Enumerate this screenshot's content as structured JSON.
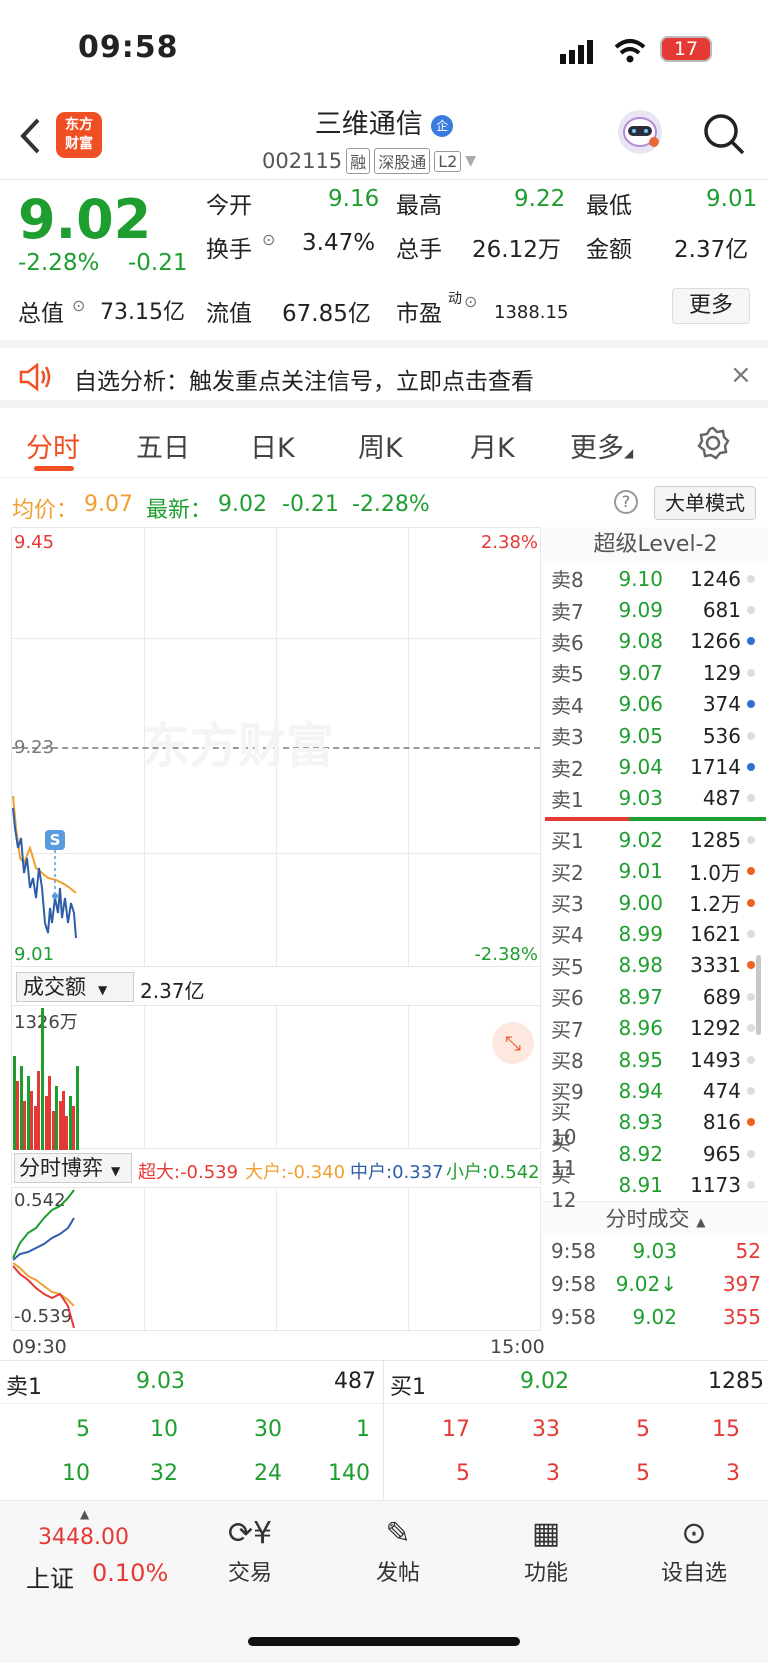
{
  "status": {
    "time": "09:58",
    "battery": "17"
  },
  "header": {
    "logo_line1": "东方",
    "logo_line2": "财富",
    "title": "三维通信",
    "code": "002115",
    "tags": [
      "融",
      "深股通",
      "L2"
    ],
    "title_badge": "企"
  },
  "quote": {
    "price": "9.02",
    "change_pct": "-2.28%",
    "change": "-0.21",
    "open_label": "今开",
    "open": "9.16",
    "high_label": "最高",
    "high": "9.22",
    "low_label": "最低",
    "low": "9.01",
    "turnover_label": "换手",
    "turnover": "3.47%",
    "volume_label": "总手",
    "volume": "26.12万",
    "amount_label": "金额",
    "amount": "2.37亿",
    "mktcap_label": "总值",
    "mktcap": "73.15亿",
    "float_label": "流值",
    "float": "67.85亿",
    "pe_label": "市盈",
    "pe_sup": "动",
    "pe": "1388.15",
    "more": "更多"
  },
  "notice": {
    "text": "自选分析：触发重点关注信号，立即点击查看"
  },
  "tabs": [
    "分时",
    "五日",
    "日K",
    "周K",
    "月K",
    "更多"
  ],
  "avgbar": {
    "avg_label": "均价：",
    "avg": "9.07",
    "latest_label": "最新：",
    "latest": "9.02",
    "chg": "-0.21",
    "pct": "-2.28%",
    "mode": "大单模式"
  },
  "chart": {
    "top_price": "9.45",
    "mid_price": "9.23",
    "bot_price": "9.01",
    "top_pct": "2.38%",
    "bot_pct": "-2.38%",
    "watermark": "东方财富",
    "signal": "S",
    "vol_label": "成交额",
    "vol_value": "2.37亿",
    "vol_max": "1326万",
    "game_label": "分时博弈",
    "chao": "超大:-0.539",
    "da": "大户:-0.340",
    "zhong": "中户:0.337",
    "xiao": "小户:0.542",
    "game_max": "0.542",
    "game_min": "-0.539",
    "t_start": "09:30",
    "t_end": "15:00"
  },
  "orderbook": {
    "title": "超级Level-2",
    "asks": [
      {
        "n": "卖8",
        "p": "9.10",
        "v": "1246"
      },
      {
        "n": "卖7",
        "p": "9.09",
        "v": "681"
      },
      {
        "n": "卖6",
        "p": "9.08",
        "v": "1266"
      },
      {
        "n": "卖5",
        "p": "9.07",
        "v": "129"
      },
      {
        "n": "卖4",
        "p": "9.06",
        "v": "374"
      },
      {
        "n": "卖3",
        "p": "9.05",
        "v": "536"
      },
      {
        "n": "卖2",
        "p": "9.04",
        "v": "1714"
      },
      {
        "n": "卖1",
        "p": "9.03",
        "v": "487"
      }
    ],
    "bids": [
      {
        "n": "买1",
        "p": "9.02",
        "v": "1285"
      },
      {
        "n": "买2",
        "p": "9.01",
        "v": "1.0万"
      },
      {
        "n": "买3",
        "p": "9.00",
        "v": "1.2万"
      },
      {
        "n": "买4",
        "p": "8.99",
        "v": "1621"
      },
      {
        "n": "买5",
        "p": "8.98",
        "v": "3331"
      },
      {
        "n": "买6",
        "p": "8.97",
        "v": "689"
      },
      {
        "n": "买7",
        "p": "8.96",
        "v": "1292"
      },
      {
        "n": "买8",
        "p": "8.95",
        "v": "1493"
      },
      {
        "n": "买9",
        "p": "8.94",
        "v": "474"
      },
      {
        "n": "买10",
        "p": "8.93",
        "v": "816"
      },
      {
        "n": "买11",
        "p": "8.92",
        "v": "965"
      },
      {
        "n": "买12",
        "p": "8.91",
        "v": "1173"
      }
    ],
    "ticks_title": "分时成交",
    "ticks": [
      {
        "t": "9:58",
        "p": "9.03",
        "v": "52"
      },
      {
        "t": "9:58",
        "p": "9.02↓",
        "v": "397"
      },
      {
        "t": "9:58",
        "p": "9.02",
        "v": "355"
      }
    ]
  },
  "level1": {
    "ask_label": "卖1",
    "ask_p": "9.03",
    "ask_v": "487",
    "bid_label": "买1",
    "bid_p": "9.02",
    "bid_v": "1285",
    "ask_q1": [
      "5",
      "10",
      "30",
      "1"
    ],
    "ask_q2": [
      "10",
      "32",
      "24",
      "140"
    ],
    "bid_q1": [
      "17",
      "33",
      "5",
      "15"
    ],
    "bid_q2": [
      "5",
      "3",
      "5",
      "3"
    ]
  },
  "nav": {
    "index_value": "3448.00",
    "index_name": "上证",
    "index_pct": "0.10%",
    "items": [
      "交易",
      "发帖",
      "功能",
      "设自选"
    ]
  }
}
